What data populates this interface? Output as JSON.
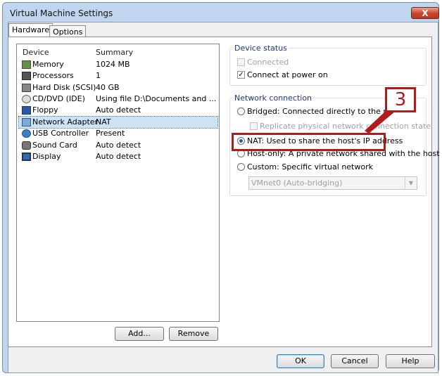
{
  "window": {
    "title": "Virtual Machine Settings",
    "close_glyph": "X"
  },
  "tabs": [
    {
      "label": "Hardware",
      "active": true
    },
    {
      "label": "Options",
      "active": false
    }
  ],
  "device_list": {
    "columns": [
      "Device",
      "Summary"
    ],
    "rows": [
      {
        "icon": "memory-icon",
        "name": "Memory",
        "summary": "1024 MB"
      },
      {
        "icon": "processor-icon",
        "name": "Processors",
        "summary": "1"
      },
      {
        "icon": "hard-disk-icon",
        "name": "Hard Disk (SCSI)",
        "summary": "40 GB"
      },
      {
        "icon": "cd-dvd-icon",
        "name": "CD/DVD (IDE)",
        "summary": "Using file D:\\Documents and ..."
      },
      {
        "icon": "floppy-icon",
        "name": "Floppy",
        "summary": "Auto detect"
      },
      {
        "icon": "network-adapter-icon",
        "name": "Network Adapter",
        "summary": "NAT",
        "selected": true
      },
      {
        "icon": "usb-icon",
        "name": "USB Controller",
        "summary": "Present"
      },
      {
        "icon": "sound-card-icon",
        "name": "Sound Card",
        "summary": "Auto detect"
      },
      {
        "icon": "display-icon",
        "name": "Display",
        "summary": "Auto detect"
      }
    ]
  },
  "buttons": {
    "add": "Add...",
    "remove": "Remove",
    "ok": "OK",
    "cancel": "Cancel",
    "help": "Help"
  },
  "device_status": {
    "label": "Device status",
    "connected": {
      "label": "Connected",
      "checked": false,
      "enabled": false
    },
    "connect_at_power_on": {
      "label": "Connect at power on",
      "checked": true
    }
  },
  "network_connection": {
    "label": "Network connection",
    "bridged": {
      "label": "Bridged: Connected directly to the physical network",
      "selected": false
    },
    "replicate": {
      "label": "Replicate physical network connection state",
      "checked": false,
      "enabled": false
    },
    "nat": {
      "label": "NAT: Used to share the host's IP address",
      "selected": true
    },
    "host_only": {
      "label": "Host-only: A private network shared with the host",
      "selected": false
    },
    "custom": {
      "label": "Custom: Specific virtual network",
      "selected": false
    },
    "vmnet_select": {
      "value": "VMnet0 (Auto-bridging)"
    }
  },
  "annotation": {
    "step_number": "3",
    "color": "#b01c1c"
  }
}
